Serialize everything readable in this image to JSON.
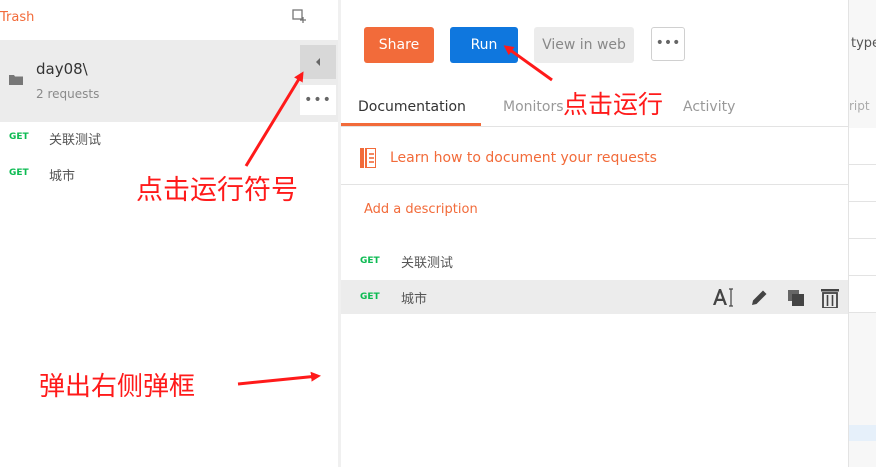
{
  "sidebar": {
    "trash_label": "Trash",
    "collection": {
      "name": "day08\\",
      "count": "2 requests",
      "more_glyph": "•••"
    },
    "requests": [
      {
        "method": "GET",
        "name": "关联测试"
      },
      {
        "method": "GET",
        "name": "城市"
      }
    ]
  },
  "panel": {
    "share_label": "Share",
    "run_label": "Run",
    "view_web_label": "View in web",
    "more_glyph": "•••",
    "tabs": {
      "documentation": "Documentation",
      "monitors": "Monitors",
      "activity": "Activity"
    },
    "learn_link": "Learn how to document your requests",
    "add_description": "Add a description",
    "requests": [
      {
        "method": "GET",
        "name": "关联测试"
      },
      {
        "method": "GET",
        "name": "城市"
      }
    ],
    "row_icons": [
      "text-format-icon",
      "pencil-icon",
      "duplicate-icon",
      "trash-icon"
    ]
  },
  "right_edge": {
    "type_label": "type",
    "ript_label": "ript"
  },
  "annotations": {
    "run": "点击运行",
    "run_symbol": "点击运行符号",
    "popup": "弹出右侧弹框"
  },
  "colors": {
    "accent_orange": "#f26b3a",
    "run_blue": "#0f77de",
    "method_green": "#0cbb52",
    "annotation_red": "#ff1a1a"
  }
}
